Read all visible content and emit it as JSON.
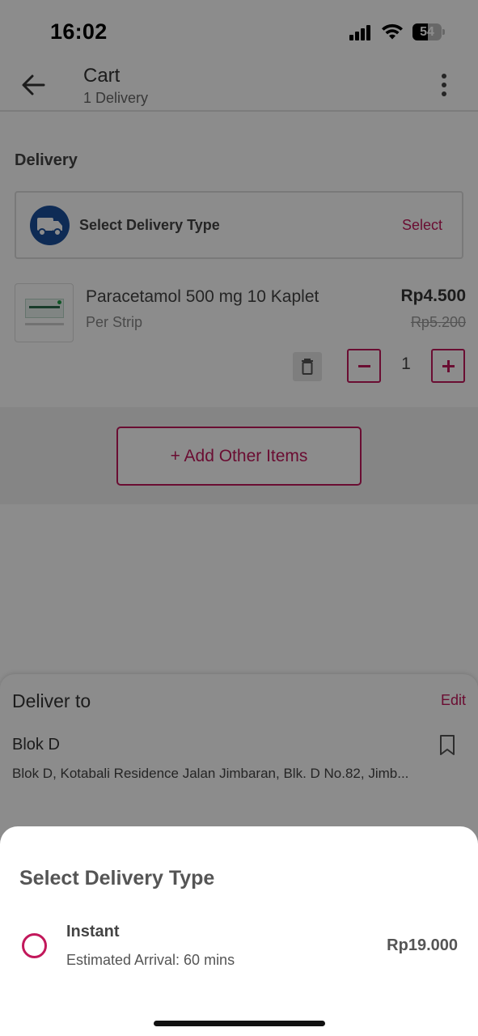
{
  "status_bar": {
    "time": "16:02",
    "battery": "54",
    "battery_level": 0.54
  },
  "header": {
    "title": "Cart",
    "subtitle": "1 Delivery"
  },
  "delivery_section": {
    "title": "Delivery",
    "delivery_type_label": "Select Delivery Type",
    "select_label": "Select"
  },
  "product": {
    "name": "Paracetamol 500 mg 10 Kaplet",
    "unit": "Per Strip",
    "price": "Rp4.500",
    "old_price": "Rp5.200",
    "quantity": "1"
  },
  "add_items_label": "+ Add Other Items",
  "deliver_to": {
    "title": "Deliver to",
    "edit_label": "Edit",
    "address_name": "Blok D",
    "address_detail": "Blok D, Kotabali Residence Jalan Jimbaran, Blk. D No.82, Jimb..."
  },
  "sheet": {
    "title": "Select Delivery Type",
    "options": [
      {
        "name": "Instant",
        "eta": "Estimated Arrival: 60 mins",
        "price": "Rp19.000",
        "selected": false
      }
    ]
  },
  "colors": {
    "accent": "#c2185b",
    "truck_badge": "#1b4f9c",
    "overlay": "#000000"
  },
  "icons": [
    "back-arrow-icon",
    "more-vert-icon",
    "truck-icon",
    "trash-icon",
    "minus-icon",
    "plus-icon",
    "bookmark-icon",
    "radio-icon",
    "signal-icon",
    "wifi-icon",
    "battery-icon"
  ]
}
